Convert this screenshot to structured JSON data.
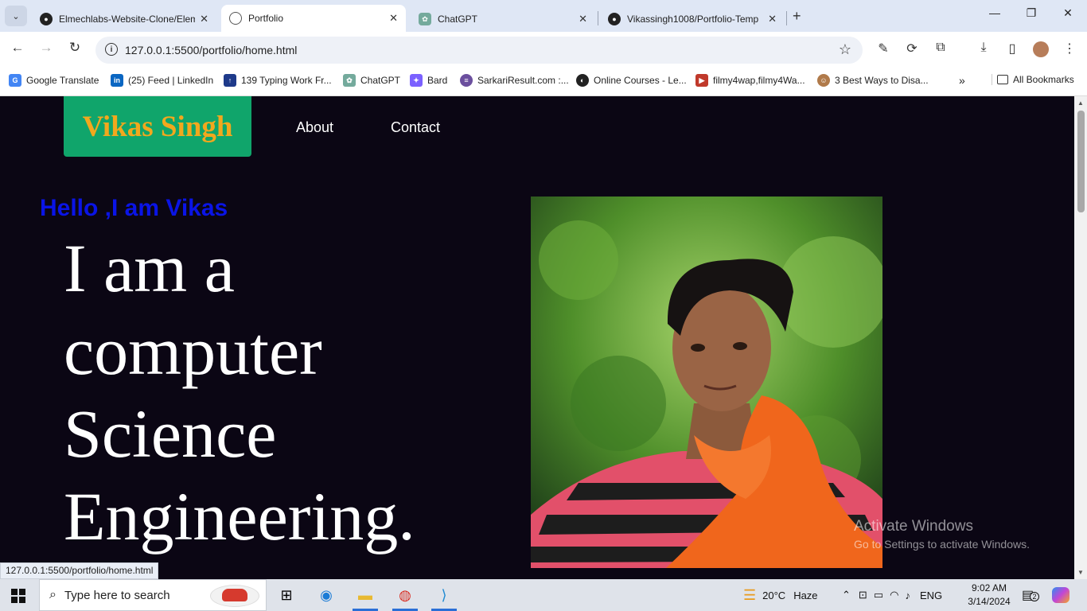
{
  "browser": {
    "tabs": [
      {
        "title": "Elmechlabs-Website-Clone/Elem",
        "favicon": "github-icon",
        "active": false
      },
      {
        "title": "Portfolio",
        "favicon": "globe-icon",
        "active": true
      },
      {
        "title": "ChatGPT",
        "favicon": "chatgpt-icon",
        "active": false
      },
      {
        "title": "Vikassingh1008/Portfolio-Temp",
        "favicon": "github-icon",
        "active": false
      }
    ],
    "url": "127.0.0.1:5500/portfolio/home.html",
    "bookmarks": [
      {
        "label": "Google Translate",
        "icon": "google-translate-icon",
        "color": "#4285f4"
      },
      {
        "label": "(25) Feed | LinkedIn",
        "icon": "linkedin-icon",
        "color": "#0a66c2"
      },
      {
        "label": "139 Typing Work Fr...",
        "icon": "typing-icon",
        "color": "#1e3a8a"
      },
      {
        "label": "ChatGPT",
        "icon": "chatgpt-icon",
        "color": "#74aa9c"
      },
      {
        "label": "Bard",
        "icon": "bard-icon",
        "color": "#7b61ff"
      },
      {
        "label": "SarkariResult.com :...",
        "icon": "sarkari-icon",
        "color": "#6b4f9e"
      },
      {
        "label": "Online Courses - Le...",
        "icon": "courses-icon",
        "color": "#222222"
      },
      {
        "label": "filmy4wap,filmy4Wa...",
        "icon": "film-icon",
        "color": "#c0392b"
      },
      {
        "label": "3 Best Ways to Disa...",
        "icon": "avatar-icon",
        "color": "#b07a4a"
      }
    ],
    "all_bookmarks_label": "All Bookmarks",
    "status_url": "127.0.0.1:5500/portfolio/home.html"
  },
  "page": {
    "brand": "Vikas Singh",
    "nav": [
      "About",
      "Contact"
    ],
    "greeting": "Hello ,I am Vikas",
    "headline": "I am a computer Science Engineering.",
    "colors": {
      "background": "#0b0614",
      "brand_bg": "#10a56b",
      "brand_text": "#f2a81d",
      "greeting": "#0a14e6"
    }
  },
  "watermark": {
    "title": "Activate Windows",
    "subtitle": "Go to Settings to activate Windows."
  },
  "taskbar": {
    "search_placeholder": "Type here to search",
    "weather_temp": "20°C",
    "weather_desc": "Haze",
    "language": "ENG",
    "time": "9:02 AM",
    "date": "3/14/2024",
    "notification_count": "2"
  }
}
